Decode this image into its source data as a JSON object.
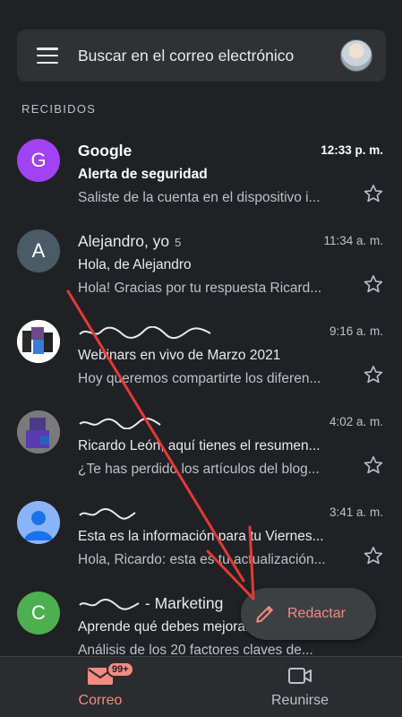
{
  "search": {
    "placeholder": "Buscar en el correo electrónico"
  },
  "section_label": "RECIBIDOS",
  "emails": [
    {
      "sender": "Google",
      "count": "",
      "time": "12:33 p. m.",
      "subject": "Alerta de seguridad",
      "snippet": "Saliste de la cuenta en el dispositivo i...",
      "avatar_letter": "G",
      "avatar_color": "#a142f4",
      "unread": true
    },
    {
      "sender": "Alejandro, yo",
      "count": "5",
      "time": "11:34 a. m.",
      "subject": "Hola, de Alejandro",
      "snippet": "Hola! Gracias por tu respuesta Ricard...",
      "avatar_letter": "A",
      "avatar_color": "#4a5b66",
      "unread": false
    },
    {
      "sender": "",
      "count": "",
      "time": "9:16 a. m.",
      "subject": "Webinars en vivo de Marzo 2021",
      "snippet": "Hoy queremos compartirte los diferen...",
      "avatar_letter": "",
      "avatar_color": "#ffffff",
      "unread": false
    },
    {
      "sender": "",
      "count": "",
      "time": "4:02 a. m.",
      "subject": "Ricardo León, aquí tienes el resumen...",
      "snippet": "¿Te has perdido los artículos del blog...",
      "avatar_letter": "",
      "avatar_color": "#6e6e6e",
      "unread": false
    },
    {
      "sender": "",
      "count": "",
      "time": "3:41 a. m.",
      "subject": "Esta es la información para tu Viernes...",
      "snippet": "Hola, Ricardo: esta es tu actualización...",
      "avatar_letter": "",
      "avatar_color": "#4f86e8",
      "unread": false
    },
    {
      "sender": "- Marketing",
      "count": "",
      "time": "",
      "subject": "Aprende qué debes mejorar",
      "snippet": "Análisis de los 20 factores claves de...",
      "avatar_letter": "C",
      "avatar_color": "#4caf50",
      "unread": false
    }
  ],
  "fab": {
    "label": "Redactar",
    "icon": "pencil-icon"
  },
  "bottom_nav": {
    "mail": {
      "label": "Correo",
      "badge": "99+",
      "icon": "mail-icon"
    },
    "meet": {
      "label": "Reunirse",
      "icon": "video-icon"
    }
  },
  "colors": {
    "accent": "#f28b82",
    "background": "#202124",
    "annotation_arrow": "#e53935"
  }
}
